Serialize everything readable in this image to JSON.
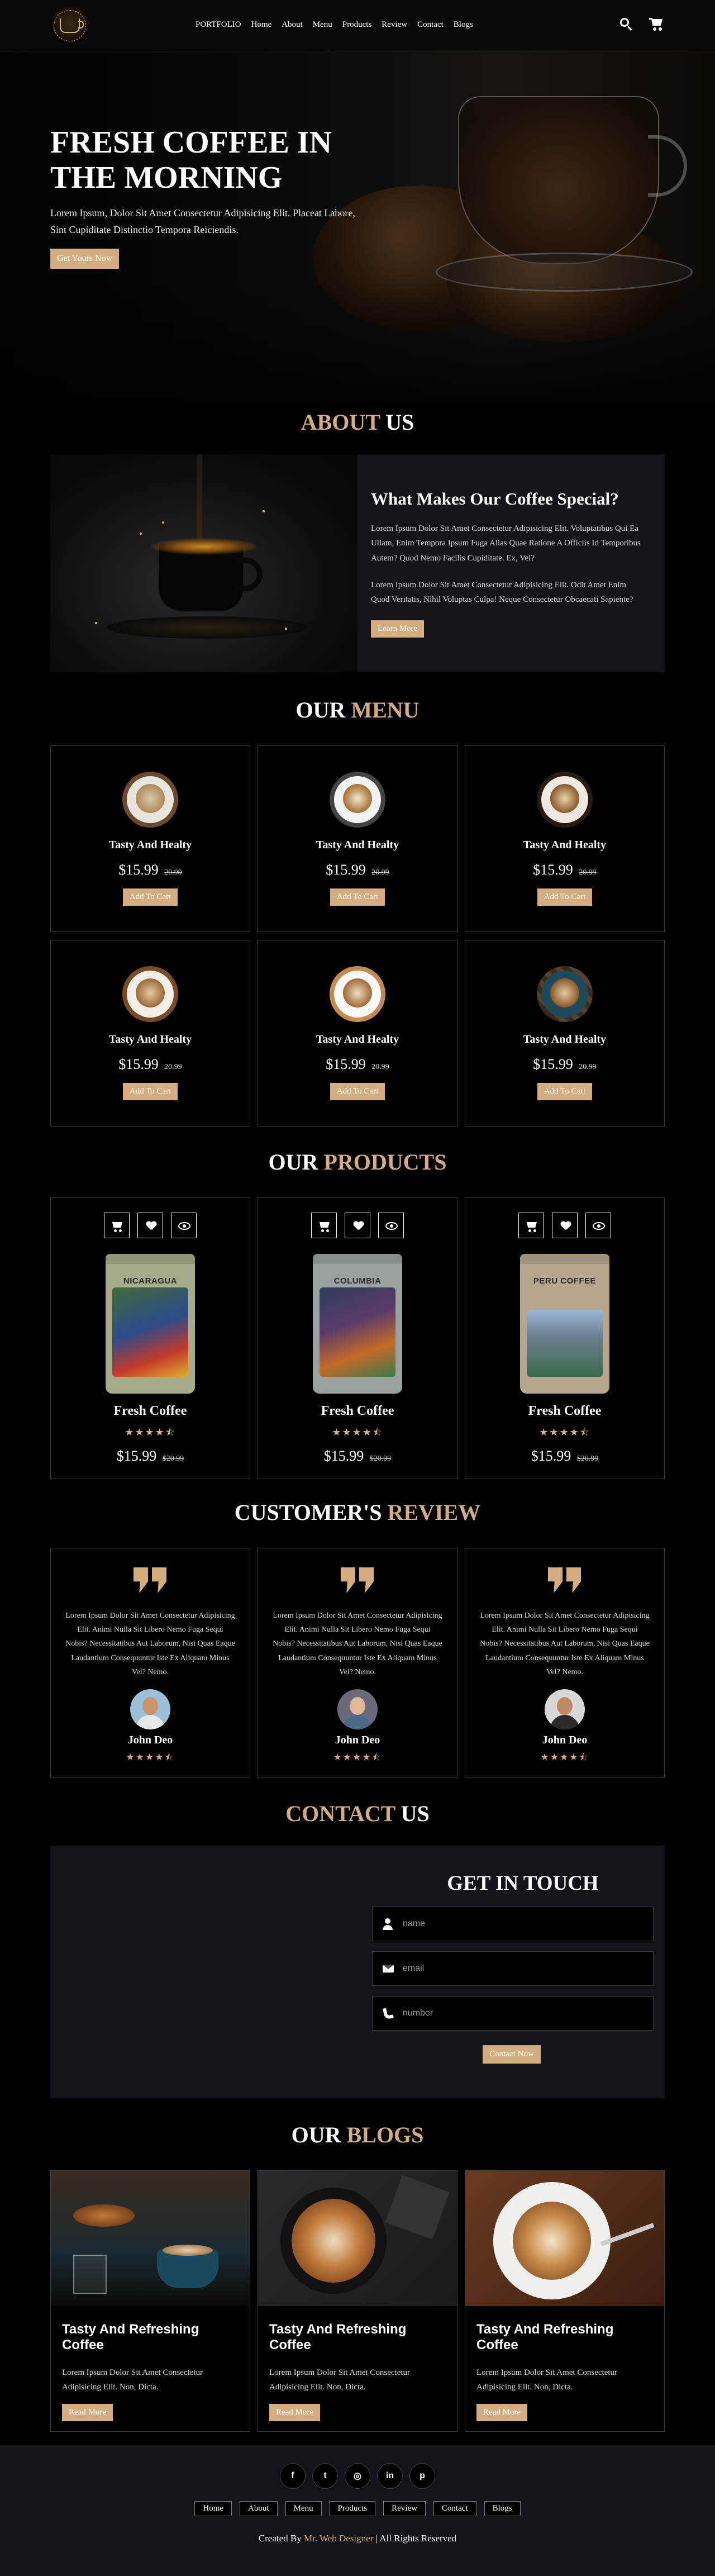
{
  "header": {
    "nav": [
      "PORTFOLIO",
      "Home",
      "About",
      "Menu",
      "Products",
      "Review",
      "Contact",
      "Blogs"
    ],
    "search_icon": "search-icon",
    "cart_icon": "cart-icon"
  },
  "hero": {
    "title": "FRESH COFFEE IN THE MORNING",
    "text": "Lorem Ipsum, Dolor Sit Amet Consectetur Adipisicing Elit. Placeat Labore, Sint Cupiditate Distinctio Tempora Reiciendis.",
    "button": "Get Yours Now"
  },
  "about": {
    "title_accent": "ABOUT",
    "title_rest": "US",
    "heading": "What Makes Our Coffee Special?",
    "p1": "Lorem Ipsum Dolor Sit Amet Consectetur Adipisicing Elit. Voluptatibus Qui Ea Ullam, Enim Tempora Ipsum Fuga Alias Quae Ratione A Officiis Id Temporibus Autem? Quod Nemo Facilis Cupiditate. Ex, Vel?",
    "p2": "Lorem Ipsum Dolor Sit Amet Consectetur Adipisicing Elit. Odit Amet Enim Quod Veritatis, Nihil Voluptas Culpa! Neque Consectetur Obcaecati Sapiente?",
    "button": "Learn More"
  },
  "menu": {
    "title_rest": "OUR",
    "title_accent": "MENU",
    "items": [
      {
        "name": "Tasty And Healty",
        "price": "$15.99",
        "old": "20.99",
        "button": "Add To Cart"
      },
      {
        "name": "Tasty And Healty",
        "price": "$15.99",
        "old": "20.99",
        "button": "Add To Cart"
      },
      {
        "name": "Tasty And Healty",
        "price": "$15.99",
        "old": "20.99",
        "button": "Add To Cart"
      },
      {
        "name": "Tasty And Healty",
        "price": "$15.99",
        "old": "20.99",
        "button": "Add To Cart"
      },
      {
        "name": "Tasty And Healty",
        "price": "$15.99",
        "old": "20.99",
        "button": "Add To Cart"
      },
      {
        "name": "Tasty And Healty",
        "price": "$15.99",
        "old": "20.99",
        "button": "Add To Cart"
      }
    ]
  },
  "products": {
    "title_rest": "OUR",
    "title_accent": "PRODUCTS",
    "items": [
      {
        "bag_label": "NICARAGUA",
        "name": "Fresh Coffee",
        "stars": "★★★★⯪",
        "price": "$15.99",
        "old": "$20.99",
        "bag_color": "#a8aa8a",
        "label_color": "#3f6b3a"
      },
      {
        "bag_label": "COLUMBIA",
        "name": "Fresh Coffee",
        "stars": "★★★★⯪",
        "price": "$15.99",
        "old": "$20.99",
        "bag_color": "#9aa2a0",
        "label_color": "#2f3e5a"
      },
      {
        "bag_label": "PERU COFFEE",
        "name": "Fresh Coffee",
        "stars": "★★★★⯪",
        "price": "$15.99",
        "old": "$20.99",
        "bag_color": "#b7a58d",
        "label_color": "#6b7f92"
      }
    ]
  },
  "review": {
    "title_rest": "CUSTOMER'S",
    "title_accent": "REVIEW",
    "items": [
      {
        "text": "Lorem Ipsum Dolor Sit Amet Consectetur Adipisicing Elit. Animi Nulla Sit Libero Nemo Fuga Sequi Nobis? Necessitatibus Aut Laborum, Nisi Quas Eaque Laudantium Consequuntur Iste Ex Aliquam Minus Vel? Nemo.",
        "name": "John Deo",
        "stars": "★★★★⯪"
      },
      {
        "text": "Lorem Ipsum Dolor Sit Amet Consectetur Adipisicing Elit. Animi Nulla Sit Libero Nemo Fuga Sequi Nobis? Necessitatibus Aut Laborum, Nisi Quas Eaque Laudantium Consequuntur Iste Ex Aliquam Minus Vel? Nemo.",
        "name": "John Deo",
        "stars": "★★★★⯪"
      },
      {
        "text": "Lorem Ipsum Dolor Sit Amet Consectetur Adipisicing Elit. Animi Nulla Sit Libero Nemo Fuga Sequi Nobis? Necessitatibus Aut Laborum, Nisi Quas Eaque Laudantium Consequuntur Iste Ex Aliquam Minus Vel? Nemo.",
        "name": "John Deo",
        "stars": "★★★★⯪"
      }
    ]
  },
  "contact": {
    "title_accent": "CONTACT",
    "title_rest": "US",
    "heading": "GET IN TOUCH",
    "name_placeholder": "name",
    "email_placeholder": "email",
    "number_placeholder": "number",
    "button": "Contact Now"
  },
  "blogs": {
    "title_rest": "OUR",
    "title_accent": "BLOGS",
    "items": [
      {
        "title": "Tasty And Refreshing Coffee",
        "text": "Lorem Ipsum Dolor Sit Amet Consectetur Adipisicing Elit. Non, Dicta.",
        "button": "Read More"
      },
      {
        "title": "Tasty And Refreshing Coffee",
        "text": "Lorem Ipsum Dolor Sit Amet Consectetur Adipisicing Elit. Non, Dicta.",
        "button": "Read More"
      },
      {
        "title": "Tasty And Refreshing Coffee",
        "text": "Lorem Ipsum Dolor Sit Amet Consectetur Adipisicing Elit. Non, Dicta.",
        "button": "Read More"
      }
    ]
  },
  "footer": {
    "socials": [
      {
        "icon": "facebook-icon",
        "glyph": "f"
      },
      {
        "icon": "twitter-icon",
        "glyph": "t"
      },
      {
        "icon": "instagram-icon",
        "glyph": "◎"
      },
      {
        "icon": "linkedin-icon",
        "glyph": "in"
      },
      {
        "icon": "pinterest-icon",
        "glyph": "p"
      }
    ],
    "links": [
      "Home",
      "About",
      "Menu",
      "Products",
      "Review",
      "Contact",
      "Blogs"
    ],
    "credit_prefix": "Created By",
    "credit_name": "Mr. Web Designer",
    "credit_suffix": "| All Rights Reserved"
  },
  "colors": {
    "accent": "#d3ad7f",
    "background": "#000000",
    "panel": "#13131a",
    "border": "#3c3c3c"
  }
}
